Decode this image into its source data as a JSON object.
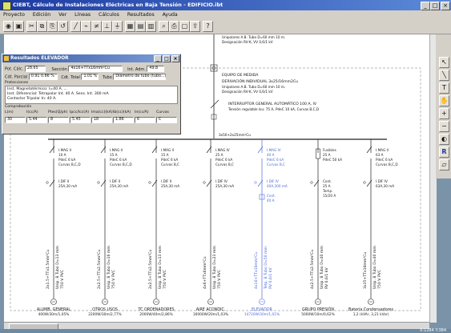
{
  "window": {
    "title": "CIEBT, Cálculo de Instalaciones Eléctricas en Baja Tensión - EDIFICIO.ibt",
    "controls": [
      "_",
      "□",
      "×"
    ]
  },
  "menu": [
    "Proyecto",
    "Edición",
    "Ver",
    "Líneas",
    "Cálculos",
    "Resultados",
    "Ayuda"
  ],
  "toolbar_icons": [
    "open-icon",
    "save-icon",
    "cut-icon",
    "copy-icon",
    "paste-icon",
    "undo-icon",
    "line-icon",
    "switch-icon",
    "fuse-icon",
    "breaker-icon",
    "ground-icon",
    "calc-icon",
    "table-icon",
    "results-icon",
    "zoom-icon",
    "print-icon",
    "preview-icon",
    "export-icon",
    "help-icon"
  ],
  "dialog": {
    "title": "Resultados ELEVADOR",
    "calc_label": "Pot. Cálc.",
    "calc_value": "28.65",
    "section_label": "Sección",
    "section_value": "4x16+TTx16mm²Cu",
    "i_label": "Int. Adm.",
    "i_value": "49.8",
    "cdt_parcial_label": "Cdt. Parcial",
    "cdt_parcial_value": "0.91 0.86 %",
    "cdt_total_label": "Cdt. Total",
    "cdt_total_value": "1.01 %",
    "tubo_label": "Tubo",
    "tubo_value": "Diámetro de tubo (tubo...)",
    "protecciones_label": "Protecciones",
    "prot_lines": [
      "Inst. Magnetotérmico: I=40 A. ...",
      "Inst. Diferencial: Tetrapolar Int. 40 A. Sens. Int. 300 mA",
      "Contactor Tripolar In: 40 A."
    ],
    "comprobacion_label": "Comprobación",
    "check_headers": [
      "L(m)",
      "I(cc/A)",
      "Ptes(Q/ph)",
      "Ipcc/Icc(A)",
      "Ima(cc)(kA)",
      "Ib(cc)(kA)",
      "In(cc/A)",
      "Curvas"
    ],
    "check_values": [
      "30",
      "5.44",
      "8",
      "5.45",
      "18",
      "1.86",
      "6",
      "C"
    ]
  },
  "top_block": {
    "lines": [
      "Unipolares A.B. Tubo D=60 mm 10 m.",
      "Designación RV-K, VV 0,6/1 kV",
      "EQUIPO DE MEDIDA",
      "DERIVACIÓN INDIVIDUAL 3x25/16mm2Cu",
      "Unipolares A.B. Tubo D=60 mm 10 m.",
      "Designación RV-K, VV 0,6/1 kV",
      "INTERRUPTOR GENERAL AUTOMÁTICO 100 A, IV",
      "Tensión regulable Isu: 75 A, PdeC 10 kA, Curvas B,C,D"
    ],
    "bus": "3x50+2x25mm²Cu"
  },
  "circuits": [
    {
      "mag": "I.MAG II",
      "a": "10 A",
      "pdc": "PdeC 6 kA",
      "curv": "Curvas B,C,D",
      "ldif": "I.DIF II",
      "ldif_s": "25A,30 mA",
      "cable": "2x1.5+TTx1.5mm²Cu",
      "tubo": "Unip. B Tubo D=13 mm",
      "v": "750 V PVC",
      "name": "ALUMB. GENERAL",
      "pow": "400W/30m/1,05%",
      "blue": false
    },
    {
      "mag": "I.MAG II",
      "a": "15 A",
      "pdc": "PdeC 6 kA",
      "curv": "Curvas B,C,D",
      "ldif": "I.DIF II",
      "ldif_s": "25A,30 mA",
      "cable": "2x2.5+TTx2.5mm²Cu",
      "tubo": "Unip. B Tubo D=16 mm",
      "v": "750 V PVC",
      "name": "OTROS USOS",
      "pow": "2200W/30m/2,77%",
      "blue": false
    },
    {
      "mag": "I.MAG II",
      "a": "15 A",
      "pdc": "PdeC 6 kA",
      "curv": "Curvas B,C",
      "ldif": "I.DIF II",
      "ldif_s": "25A,30 mA",
      "cable": "2x2.5+TTx2.5mm²Cu",
      "tubo": "Unip. B Tubo D=13 mm",
      "v": "750 V PVC",
      "name": "TC ORDENADORES",
      "pow": "2000W/40m/2,86%",
      "blue": false
    },
    {
      "mag": "I.MAG IV",
      "a": "25 A",
      "pdc": "PdeC 6 kA",
      "curv": "Curvas B,C",
      "ldif": "I.DIF IV",
      "ldif_s": "25A,30 mA",
      "cable": "4x6+TTx6mm²Cu",
      "tubo": "Unip. B Tubo D=23 mm",
      "v": "750 V PVC",
      "name": "AIRE ACONDIC.",
      "pow": "16000W/20m/1,03%",
      "blue": false
    },
    {
      "mag": "I.MAG IV",
      "a": "40 A",
      "pdc": "PdeC 6 kA",
      "curv": "Curvas B,C",
      "ldif": "I.DIF IV",
      "ldif_s": "40A,300 mA",
      "cont": "Cont.",
      "cont_a": "40 A",
      "cable": "4x16+TTx16mm²Cu",
      "tubo": "Tetp. B Tubo D=50 mm",
      "v": "RV 0,6/1 kV",
      "name": "ELEVADOR",
      "pow": "14720W/30m/1,01%",
      "blue": true
    },
    {
      "mag": "Fusibles",
      "a": "25 A",
      "pdc": "PdeC 50 kA",
      "curv": "",
      "ldif": "Cont.",
      "ldif_s": "25 A",
      "extra": "Tomp.",
      "extra2": "15/20 A",
      "cable": "4x2.5+TTx2.5mm²Cu",
      "tubo": "Unip. B Tubo D=40 mm",
      "v": "RV 0,6/1 kV",
      "name": "GRUPO PRESIÓN",
      "pow": "5000W/10m/0,62%",
      "blue": false
    },
    {
      "mag": "I.MAG II",
      "a": "63 A",
      "pdc": "PdeC 6 kA",
      "curv": "Curvas B,C,D",
      "ldif": "I.DIF IV",
      "ldif_s": "63A,30 mA",
      "cable": "3x35+TTx16mm²Cu",
      "tubo": "Unip. B Tubo D=40 mm",
      "v": "750 V PVC",
      "name": "Batería Condensadores",
      "pow": "1,2 (kVAr, 3,21 kVar)",
      "blue": false
    }
  ],
  "right_tools": [
    "pointer-icon",
    "line-tool-icon",
    "text-tool-icon",
    "hand-icon",
    "zoom-in-icon",
    "zoom-out-icon",
    "palette-icon",
    "r-icon",
    "eraser-icon"
  ],
  "status": {
    "coords": "X:1284  Y:384"
  },
  "colors": {
    "titlebar": "#1c3aa2",
    "desktop": "#7a93a8",
    "selected_circuit": "#4f6bd8"
  }
}
